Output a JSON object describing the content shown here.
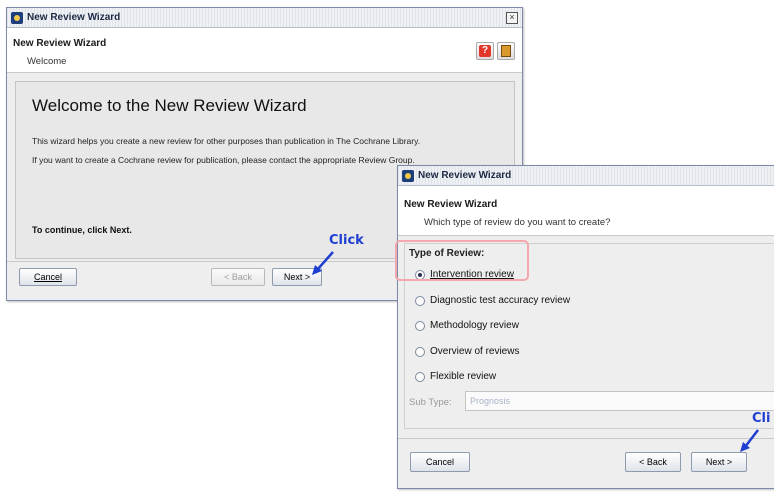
{
  "window1": {
    "title": "New Review Wizard",
    "header_title": "New Review Wizard",
    "header_subtitle": "Welcome",
    "heading": "Welcome to the New Review Wizard",
    "para1": "This wizard helps you create a new review for other purposes than publication in The Cochrane Library.",
    "para2": "If you want to create a Cochrane review for publication, please contact the appropriate Review Group.",
    "continue_text": "To continue, click Next.",
    "cancel_label": "Cancel",
    "back_label": "< Back",
    "next_label": "Next >",
    "help_icon": "question-icon",
    "book_icon": "book-icon"
  },
  "window2": {
    "title": "New Review Wizard",
    "header_title": "New Review Wizard",
    "header_subtitle": "Which type of review do you want to create?",
    "group_label": "Type of Review:",
    "options": [
      {
        "label": "Intervention review",
        "checked": true
      },
      {
        "label": "Diagnostic test accuracy review",
        "checked": false
      },
      {
        "label": "Methodology review",
        "checked": false
      },
      {
        "label": "Overview of reviews",
        "checked": false
      },
      {
        "label": "Flexible review",
        "checked": false
      }
    ],
    "subtype_label": "Sub Type:",
    "subtype_value": "Prognosis",
    "cancel_label": "Cancel",
    "back_label": "< Back",
    "next_label": "Next >"
  },
  "annotations": {
    "click1": "Click",
    "click2": "Cli",
    "arrow_color": "#1f3fd1",
    "highlight_color": "#f4a7ad"
  }
}
